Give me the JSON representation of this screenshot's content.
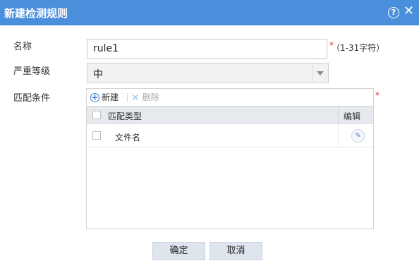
{
  "dialog": {
    "title": "新建检测规则",
    "help_glyph": "?",
    "close_glyph": "✕"
  },
  "form": {
    "name_label": "名称",
    "name_value": "rule1",
    "name_required": "*",
    "name_hint": "（1-31字符）",
    "severity_label": "严重等级",
    "severity_value": "中",
    "condition_label": "匹配条件",
    "condition_required": "*"
  },
  "grid": {
    "toolbar": {
      "new_icon": "+",
      "new_label": "新建",
      "delete_icon": "✕",
      "delete_label": "删除"
    },
    "columns": [
      "匹配类型",
      "编辑"
    ],
    "rows": [
      {
        "type": "文件名"
      }
    ]
  },
  "buttons": {
    "ok": "确定",
    "cancel": "取消"
  },
  "colors": {
    "titlebar": "#4a8fdc",
    "required": "#ee2222",
    "button_bg": "#dfe5ee"
  }
}
